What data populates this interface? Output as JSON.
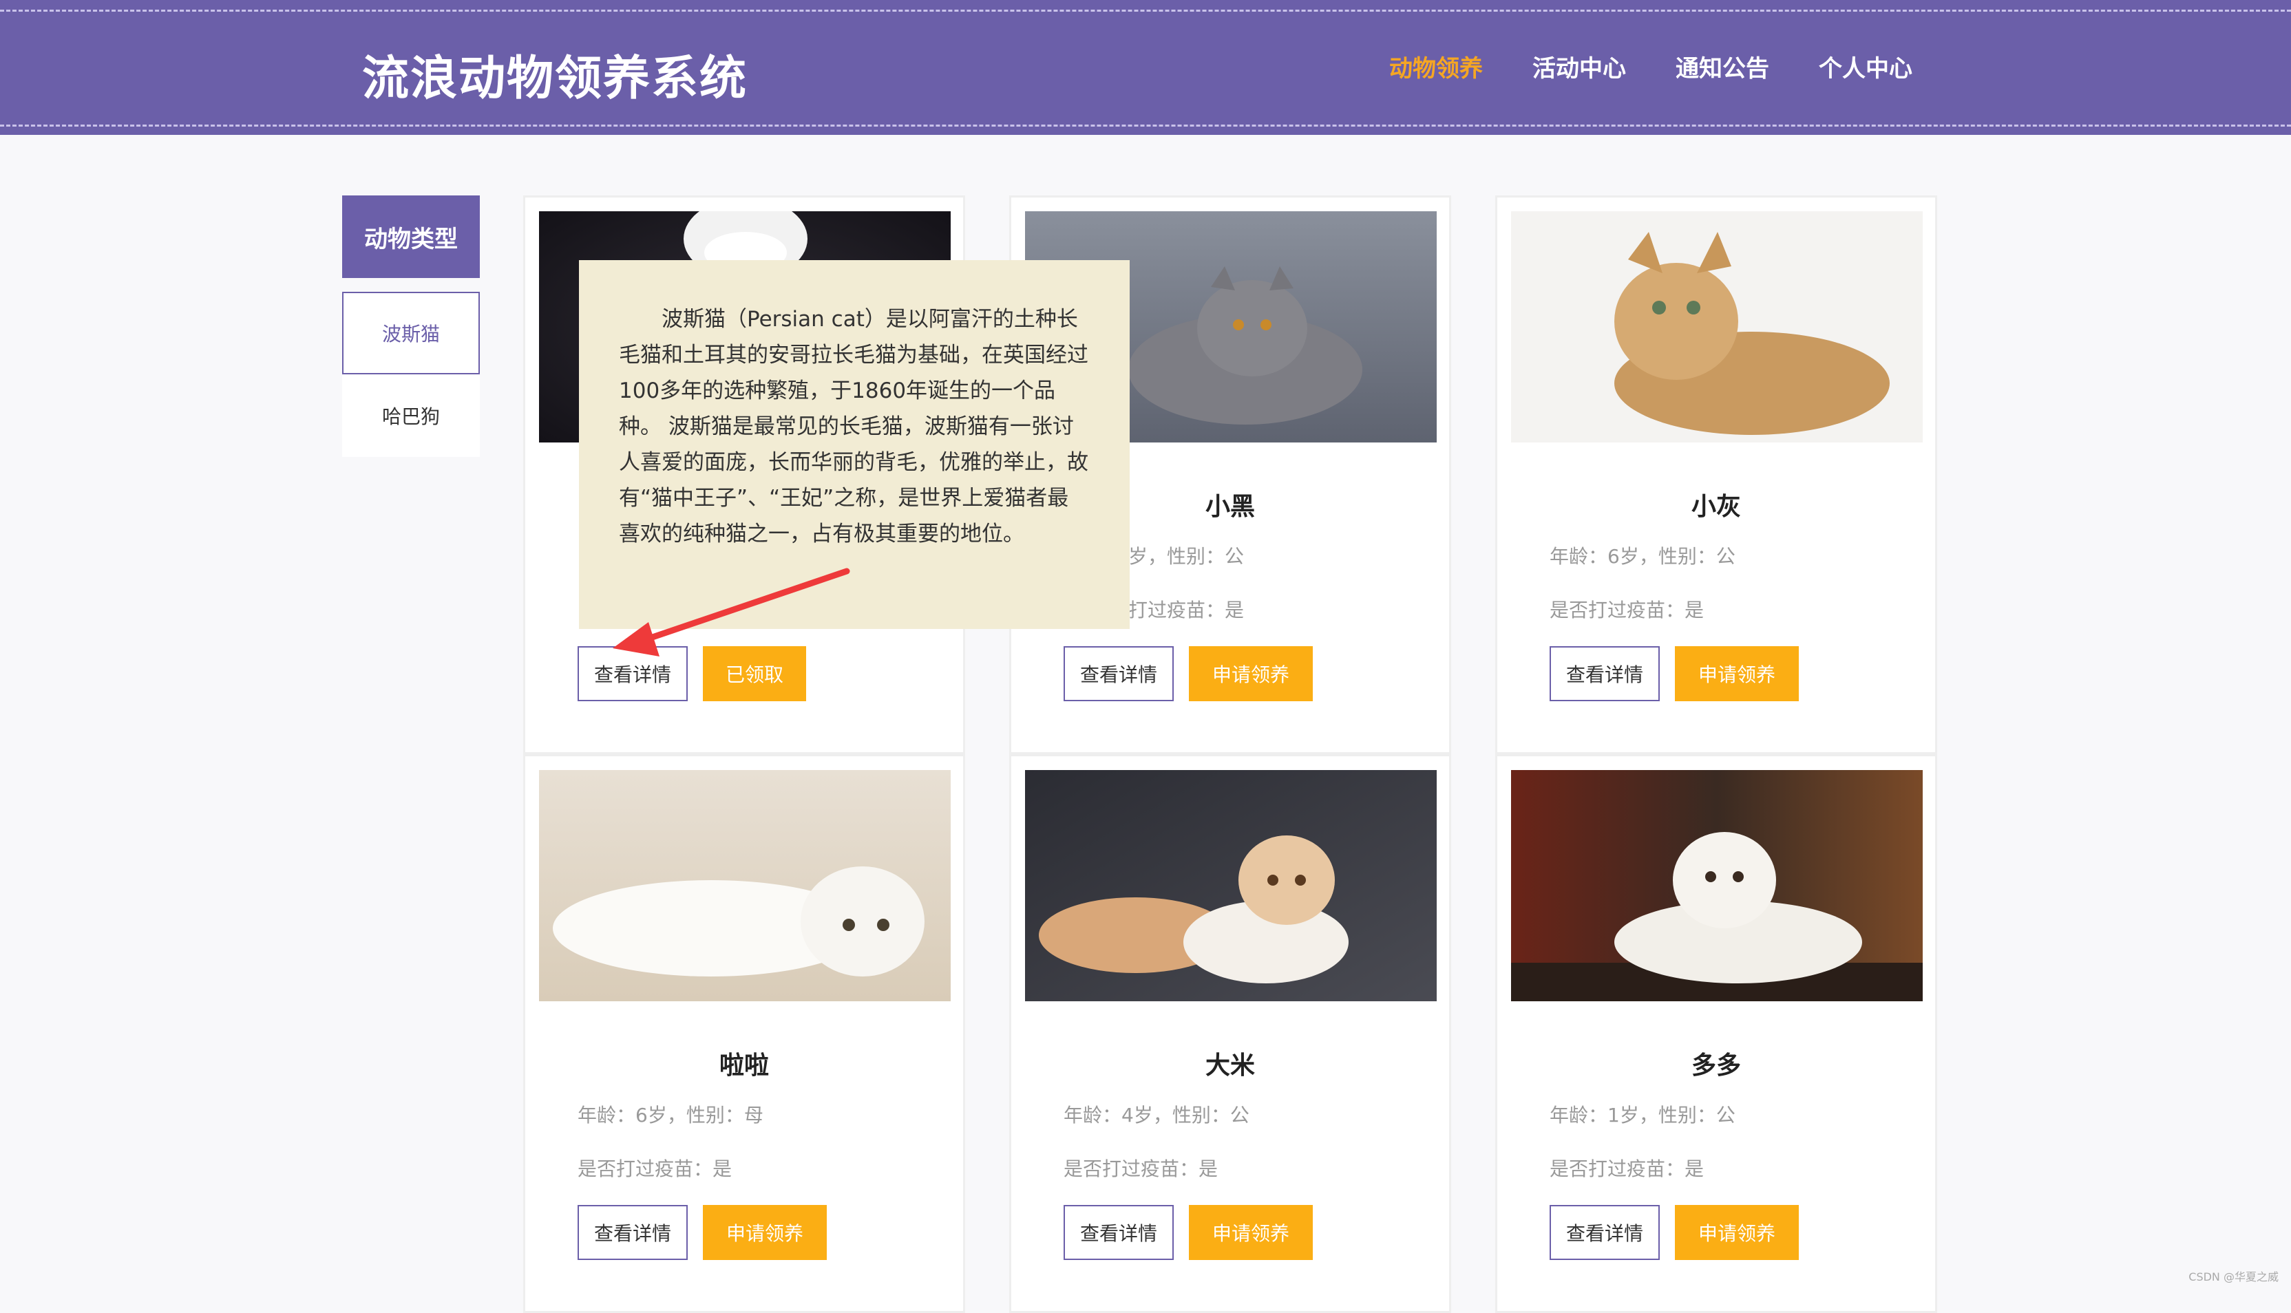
{
  "header": {
    "title": "流浪动物领养系统",
    "nav": [
      "动物领养",
      "活动中心",
      "通知公告",
      "个人中心"
    ],
    "active_index": 0
  },
  "sidebar": {
    "heading": "动物类型",
    "items": [
      "波斯猫",
      "哈巴狗"
    ]
  },
  "cards": [
    {
      "name": "",
      "age": "",
      "vaccine": "",
      "detail_label": "查看详情",
      "action_label": "已领取",
      "image": "white-cat-dark-bg"
    },
    {
      "name": "小黑",
      "age": "岁，性别：公",
      "vaccine": "打过疫苗：是",
      "detail_label": "查看详情",
      "action_label": "申请领养",
      "image": "grey-persian"
    },
    {
      "name": "小灰",
      "age": "年龄：6岁，性别：公",
      "vaccine": "是否打过疫苗：是",
      "detail_label": "查看详情",
      "action_label": "申请领养",
      "image": "golden-persian"
    },
    {
      "name": "啦啦",
      "age": "年龄：6岁，性别：母",
      "vaccine": "是否打过疫苗：是",
      "detail_label": "查看详情",
      "action_label": "申请领养",
      "image": "white-persian-floor"
    },
    {
      "name": "大米",
      "age": "年龄：4岁，性别：公",
      "vaccine": "是否打过疫苗：是",
      "detail_label": "查看详情",
      "action_label": "申请领养",
      "image": "cream-persian"
    },
    {
      "name": "多多",
      "age": "年龄：1岁，性别：公",
      "vaccine": "是否打过疫苗：是",
      "detail_label": "查看详情",
      "action_label": "申请领养",
      "image": "white-kitten"
    }
  ],
  "tooltip": {
    "text": "波斯猫（Persian cat）是以阿富汗的土种长毛猫和土耳其的安哥拉长毛猫为基础，在英国经过100多年的选种繁殖，于1860年诞生的一个品种。 波斯猫是最常见的长毛猫，波斯猫有一张讨人喜爱的面庞，长而华丽的背毛，优雅的举止，故有“猫中王子”、“王妃”之称，是世界上爱猫者最喜欢的纯种猫之一，占有极其重要的地位。"
  },
  "credit": "CSDN @华夏之威",
  "colors": {
    "purple": "#6b5fa9",
    "orange": "#fbae14",
    "active_nav": "#f5a623",
    "tooltip_bg": "#f2ecd4",
    "arrow": "#ee3a3a"
  }
}
